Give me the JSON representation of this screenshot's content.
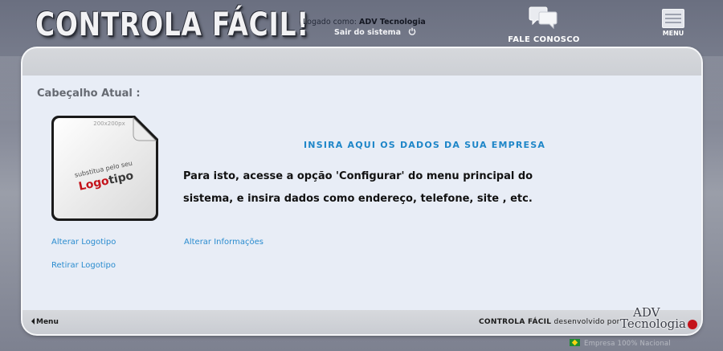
{
  "header": {
    "app_title": "CONTROLA FÁCIL!",
    "logged_label": "Logado como:",
    "logged_user": "ADV Tecnologia",
    "logout_label": "Sair do sistema",
    "contact_label": "FALE CONOSCO",
    "menu_label": "MENU"
  },
  "content": {
    "section_title": "Cabeçalho Atual :",
    "logo_placeholder": {
      "size_label": "200x200px",
      "hint": "substitua pelo seu",
      "word_accent": "Logo",
      "word_rest": "tipo"
    },
    "company_heading": "INSIRA AQUI OS DADOS DA SUA EMPRESA",
    "instruction_line1": "Para isto, acesse a opção 'Configurar' do menu principal do",
    "instruction_line2": "sistema, e insira dados como endereço, telefone, site , etc.",
    "links": {
      "change_logo": "Alterar Logotipo",
      "remove_logo": "Retirar Logotipo",
      "change_info": "Alterar Informações"
    }
  },
  "footer": {
    "back_menu": "Menu",
    "brand": "CONTROLA FÁCIL",
    "credit": "desenvolvido por",
    "dev_name_1": "ADV",
    "dev_name_2": "Tecnologia",
    "national": "Empresa 100% Nacional"
  },
  "colors": {
    "accent_blue": "#1e86c8",
    "link_blue": "#2a8ccf",
    "logo_red": "#c4131b"
  }
}
